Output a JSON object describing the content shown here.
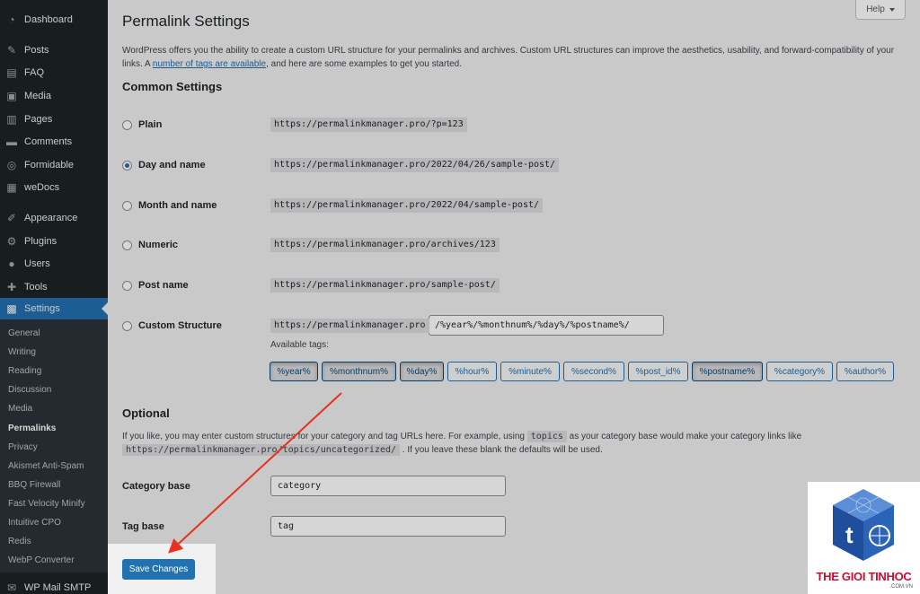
{
  "sidebar": {
    "items": [
      {
        "label": "Dashboard",
        "icon": "dashboard-icon"
      },
      {
        "label": "Posts",
        "icon": "pin-icon"
      },
      {
        "label": "FAQ",
        "icon": "faq-icon"
      },
      {
        "label": "Media",
        "icon": "media-icon"
      },
      {
        "label": "Pages",
        "icon": "pages-icon"
      },
      {
        "label": "Comments",
        "icon": "comments-icon"
      },
      {
        "label": "Formidable",
        "icon": "formidable-icon"
      },
      {
        "label": "weDocs",
        "icon": "docs-icon"
      },
      {
        "label": "Appearance",
        "icon": "brush-icon"
      },
      {
        "label": "Plugins",
        "icon": "plugin-icon"
      },
      {
        "label": "Users",
        "icon": "user-icon"
      },
      {
        "label": "Tools",
        "icon": "wrench-icon"
      },
      {
        "label": "Settings",
        "icon": "settings-icon"
      }
    ],
    "submenu": [
      "General",
      "Writing",
      "Reading",
      "Discussion",
      "Media",
      "Permalinks",
      "Privacy",
      "Akismet Anti-Spam",
      "BBQ Firewall",
      "Fast Velocity Minify",
      "Intuitive CPO",
      "Redis",
      "WebP Converter"
    ],
    "bottom_item": {
      "label": "WP Mail SMTP",
      "icon": "mail-icon"
    }
  },
  "help": {
    "label": "Help"
  },
  "page": {
    "title": "Permalink Settings",
    "intro_1": "WordPress offers you the ability to create a custom URL structure for your permalinks and archives. Custom URL structures can improve the aesthetics, usability, and forward-compatibility of your links. A ",
    "intro_link": "number of tags are available",
    "intro_2": ", and here are some examples to get you started."
  },
  "common": {
    "heading": "Common Settings",
    "options": [
      {
        "label": "Plain",
        "example": "https://permalinkmanager.pro/?p=123"
      },
      {
        "label": "Day and name",
        "example": "https://permalinkmanager.pro/2022/04/26/sample-post/"
      },
      {
        "label": "Month and name",
        "example": "https://permalinkmanager.pro/2022/04/sample-post/"
      },
      {
        "label": "Numeric",
        "example": "https://permalinkmanager.pro/archives/123"
      },
      {
        "label": "Post name",
        "example": "https://permalinkmanager.pro/sample-post/"
      },
      {
        "label": "Custom Structure",
        "example": "https://permalinkmanager.pro"
      }
    ],
    "selected": "Day and name",
    "custom_value": "/%year%/%monthnum%/%day%/%postname%/",
    "available_tags_label": "Available tags:",
    "tags": [
      {
        "label": "%year%",
        "pressed": true
      },
      {
        "label": "%monthnum%",
        "pressed": true
      },
      {
        "label": "%day%",
        "pressed": true
      },
      {
        "label": "%hour%",
        "pressed": false
      },
      {
        "label": "%minute%",
        "pressed": false
      },
      {
        "label": "%second%",
        "pressed": false
      },
      {
        "label": "%post_id%",
        "pressed": false
      },
      {
        "label": "%postname%",
        "pressed": true
      },
      {
        "label": "%category%",
        "pressed": false
      },
      {
        "label": "%author%",
        "pressed": false
      }
    ]
  },
  "optional": {
    "heading": "Optional",
    "desc_1": "If you like, you may enter custom structures for your category and tag URLs here. For example, using ",
    "desc_code": "topics",
    "desc_2": " as your category base would make your category links like",
    "desc_code_2": "https://permalinkmanager.pro/topics/uncategorized/",
    "desc_3": " . If you leave these blank the defaults will be used.",
    "category_label": "Category base",
    "category_value": "category",
    "tag_label": "Tag base",
    "tag_value": "tag"
  },
  "save": {
    "label": "Save Changes"
  },
  "colors": {
    "accent": "#2271b1",
    "annotation": "#e8321f",
    "brand_red": "#c8102e",
    "brand_blue": "#1e4e9c"
  },
  "logo": {
    "text": "THE GIOI TINHOC",
    "sub": ".COM.VN"
  }
}
